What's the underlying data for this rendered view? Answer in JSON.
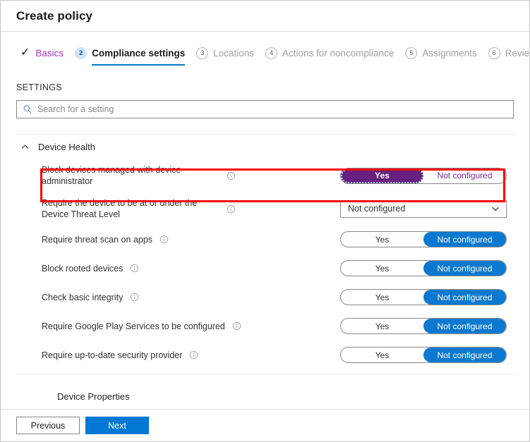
{
  "window": {
    "title": "Create policy"
  },
  "wizard": {
    "steps": [
      {
        "marker": "check",
        "icon": "check-icon",
        "label": "Basics",
        "state": "done"
      },
      {
        "marker": "2",
        "label": "Compliance settings",
        "state": "current"
      },
      {
        "marker": "3",
        "label": "Locations",
        "state": "upcoming"
      },
      {
        "marker": "4",
        "label": "Actions for noncompliance",
        "state": "upcoming"
      },
      {
        "marker": "5",
        "label": "Assignments",
        "state": "upcoming"
      },
      {
        "marker": "6",
        "label": "Review",
        "state": "upcoming"
      }
    ]
  },
  "settings": {
    "section_label": "SETTINGS",
    "search": {
      "placeholder": "Search for a setting",
      "value": "",
      "icon": "search-icon"
    },
    "group": {
      "name": "Device Health",
      "expanded": true,
      "chevron_icon": "chevron-up-icon"
    },
    "clipped_group_below": "Device Properties",
    "rows": [
      {
        "label": "Block devices managed with device administrator",
        "info_icon": "info-icon",
        "control": "toggle",
        "options": [
          "Yes",
          "Not configured"
        ],
        "selected": "Yes",
        "accent": "#67207f",
        "highlighted": true,
        "focused": true
      },
      {
        "label": "Require the device to be at or under the Device Threat Level",
        "info_icon": "info-icon",
        "control": "dropdown",
        "value": "Not configured",
        "caret_icon": "chevron-down-icon",
        "highlighted": false
      },
      {
        "label": "Require threat scan on apps",
        "info_icon": "info-icon",
        "control": "toggle",
        "options": [
          "Yes",
          "Not configured"
        ],
        "selected": "Not configured",
        "accent": "#0b79d0",
        "highlighted": false
      },
      {
        "label": "Block rooted devices",
        "info_icon": "info-icon",
        "control": "toggle",
        "options": [
          "Yes",
          "Not configured"
        ],
        "selected": "Not configured",
        "accent": "#0b79d0",
        "highlighted": false
      },
      {
        "label": "Check basic integrity",
        "info_icon": "info-icon",
        "control": "toggle",
        "options": [
          "Yes",
          "Not configured"
        ],
        "selected": "Not configured",
        "accent": "#0b79d0",
        "highlighted": false
      },
      {
        "label": "Require Google Play Services to be configured",
        "info_icon": "info-icon",
        "control": "toggle",
        "options": [
          "Yes",
          "Not configured"
        ],
        "selected": "Not configured",
        "accent": "#0b79d0",
        "highlighted": false
      },
      {
        "label": "Require up-to-date security provider",
        "info_icon": "info-icon",
        "control": "toggle",
        "options": [
          "Yes",
          "Not configured"
        ],
        "selected": "Not configured",
        "accent": "#0b79d0",
        "highlighted": false
      }
    ]
  },
  "footer": {
    "previous_label": "Previous",
    "next_label": "Next"
  },
  "colors": {
    "blue_accent": "#0078d4",
    "toggle_blue": "#0b79d0",
    "toggle_purple": "#67207f",
    "visited_link_purple": "#a437c0",
    "highlight_red": "#ff0000"
  }
}
